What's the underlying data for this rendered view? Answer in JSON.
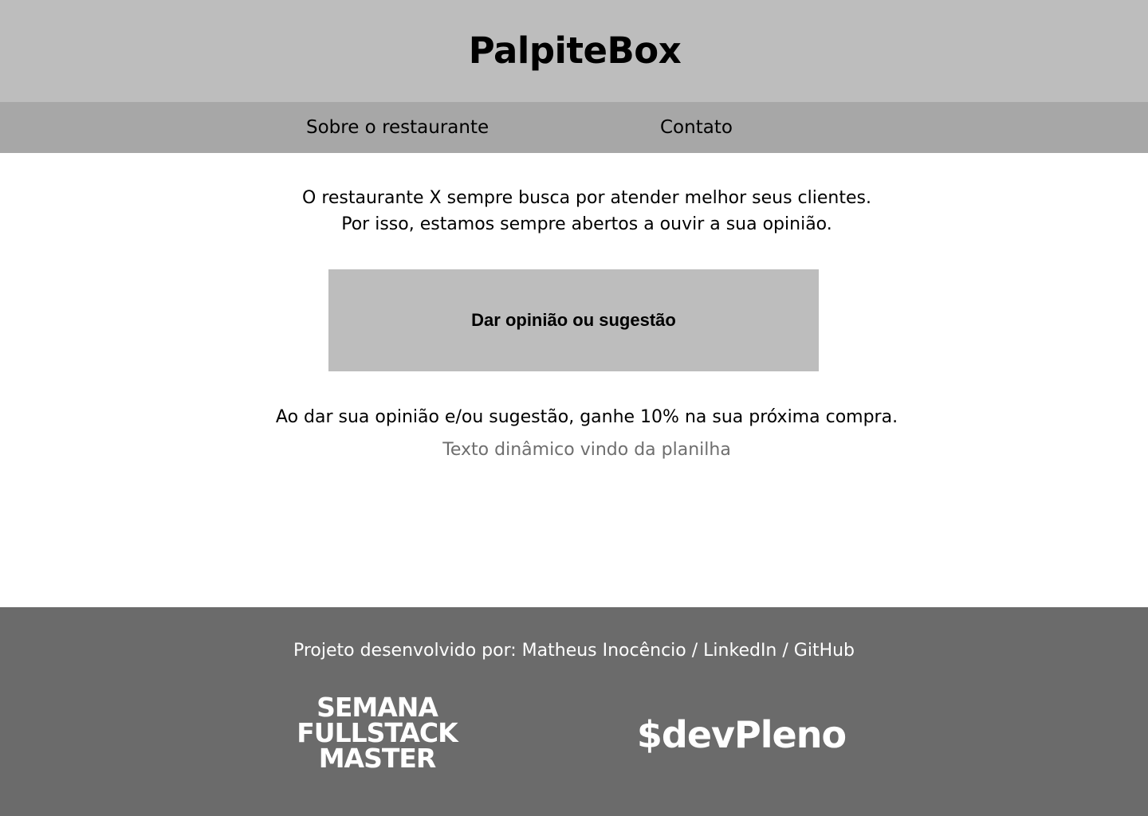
{
  "header": {
    "brand": "PalpiteBox"
  },
  "nav": {
    "items": [
      {
        "label": "Sobre o restaurante"
      },
      {
        "label": "Contato"
      }
    ]
  },
  "main": {
    "intro_line1": "O restaurante X sempre busca por atender melhor seus clientes.",
    "intro_line2": "Por isso, estamos sempre abertos a ouvir a sua opinião.",
    "cta_label": "Dar opinião ou sugestão",
    "promo_text": "Ao dar sua opinião e/ou sugestão, ganhe 10% na sua próxima compra.",
    "dynamic_text": "Texto dinâmico vindo da planilha"
  },
  "footer": {
    "credits_prefix": "Projeto desenvolvido por: ",
    "author_link": "Matheus Inocêncio",
    "separator1": " / ",
    "linkedin_link": "LinkedIn",
    "separator2": " / ",
    "github_link": "GitHub",
    "logo_semana_lines": [
      "SEMANA",
      "FULLSTACK",
      "MASTER"
    ],
    "logo_devpleno": "$devPleno"
  },
  "colors": {
    "header_bg": "#bdbdbd",
    "nav_bg": "#a7a7a7",
    "button_bg": "#bdbdbd",
    "footer_bg": "#6b6b6b",
    "dynamic_text": "#6e6e6e"
  }
}
